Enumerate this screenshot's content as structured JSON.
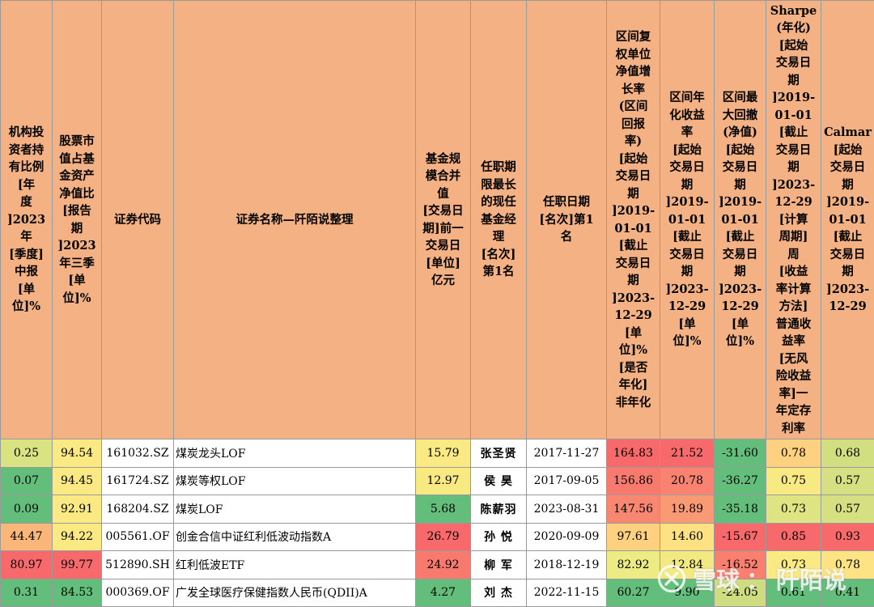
{
  "headers": [
    "机构投\n资者持\n有比例\n[年\n度\n]2023\n年\n[季度]\n中报\n[单\n位]%",
    "股票市\n值占基\n金资产\n净值比\n[报告\n期\n]2023\n年三季\n[单\n位]%",
    "证券代码",
    "证券名称—阡陌说整理",
    "基金规\n模合并\n值\n[交易日\n期]前一\n交易日\n[单位]\n亿元",
    "任职期\n限最长\n的现任\n基金经\n理\n[名次]\n第1名",
    "任职日期\n[名次]第1\n名",
    "区间复\n权单位\n净值增\n长率\n(区间\n回报\n率)\n[起始\n交易日\n期\n]2019-\n01-01\n[截止\n交易日\n期\n]2023-\n12-29\n[单\n位]%\n[是否\n年化]\n非年化",
    "区间年\n化收益\n率\n[起始\n交易日\n期\n]2019-\n01-01\n[截止\n交易日\n期\n]2023-\n12-29\n[单\n位]%",
    "区间最\n大回撤\n(净值)\n[起始\n交易日\n期\n]2019-\n01-01\n[截止\n交易日\n期\n]2023-\n12-29\n[单\n位]%",
    "Sharpe\n(年化)\n[起始\n交易日\n期\n]2019-\n01-01\n[截止\n交易日\n期\n]2023-\n12-29\n[计算\n周期]\n周\n[收益\n率计算\n方法]\n普通收\n益率\n[无风\n险收益\n率]一\n年定存\n利率",
    "Calmar\n[起始\n交易日\n期\n]2019-\n01-01\n[截止\n交易日\n期\n]2023-\n12-29"
  ],
  "rows": [
    [
      "0.25",
      "94.54",
      "161032.SZ",
      "煤炭龙头LOF",
      "15.79",
      "张圣贤",
      "2017-11-27",
      "164.83",
      "21.52",
      "-31.60",
      "0.78",
      "0.68"
    ],
    [
      "0.07",
      "94.45",
      "161724.SZ",
      "煤炭等权LOF",
      "12.97",
      "侯 昊",
      "2017-09-05",
      "156.86",
      "20.78",
      "-36.27",
      "0.75",
      "0.57"
    ],
    [
      "0.09",
      "92.91",
      "168204.SZ",
      "煤炭LOF",
      "5.68",
      "陈薪羽",
      "2023-08-31",
      "147.56",
      "19.89",
      "-35.18",
      "0.73",
      "0.57"
    ],
    [
      "44.47",
      "94.22",
      "005561.OF",
      "创金合信中证红利低波动指数A",
      "26.79",
      "孙 悦",
      "2020-09-09",
      "97.61",
      "14.60",
      "-15.67",
      "0.85",
      "0.93"
    ],
    [
      "80.97",
      "99.77",
      "512890.SH",
      "红利低波ETF",
      "24.92",
      "柳 军",
      "2018-12-19",
      "82.92",
      "12.84",
      "-16.52",
      "0.73",
      "0.78"
    ],
    [
      "0.31",
      "84.53",
      "000369.OF",
      "广发全球医疗保健指数人民币(QDII)A",
      "4.27",
      "刘 杰",
      "2022-11-15",
      "60.27",
      "9.90",
      "-24.05",
      "0.61",
      "0.41"
    ]
  ],
  "cell_colors": [
    [
      "#d9e382",
      "#fbe983",
      "#ffffff",
      "#ffffff",
      "#fbe983",
      "#ffffff",
      "#ffffff",
      "#f8696b",
      "#f8696b",
      "#63be7b",
      "#fdd17f",
      "#d2df81"
    ],
    [
      "#63be7b",
      "#fbe983",
      "#ffffff",
      "#ffffff",
      "#f9e983",
      "#ffffff",
      "#ffffff",
      "#f87a6e",
      "#f98370",
      "#63be7b",
      "#f8e983",
      "#d4e082"
    ],
    [
      "#63be7b",
      "#fbe983",
      "#ffffff",
      "#ffffff",
      "#63be7b",
      "#ffffff",
      "#ffffff",
      "#f98670",
      "#fa9a74",
      "#63be7b",
      "#dfe482",
      "#d6e082"
    ],
    [
      "#fbb779",
      "#fbe983",
      "#ffffff",
      "#ffffff",
      "#f8696b",
      "#ffffff",
      "#ffffff",
      "#fdd17f",
      "#fde183",
      "#f8696b",
      "#f8696b",
      "#f8696b"
    ],
    [
      "#f8696b",
      "#f8696b",
      "#ffffff",
      "#ffffff",
      "#f87a6e",
      "#ffffff",
      "#ffffff",
      "#edeb84",
      "#f2e983",
      "#fa7f6f",
      "#fbe983",
      "#fde383"
    ],
    [
      "#63be7b",
      "#63be7b",
      "#ffffff",
      "#ffffff",
      "#63be7b",
      "#ffffff",
      "#ffffff",
      "#63be7b",
      "#63be7b",
      "#cfdd81",
      "#63be7b",
      "#63be7b"
    ]
  ],
  "watermark": {
    "site": "雪球",
    "separator": "：",
    "author": "阡陌说",
    "icon": "xueqiu-logo-icon"
  }
}
